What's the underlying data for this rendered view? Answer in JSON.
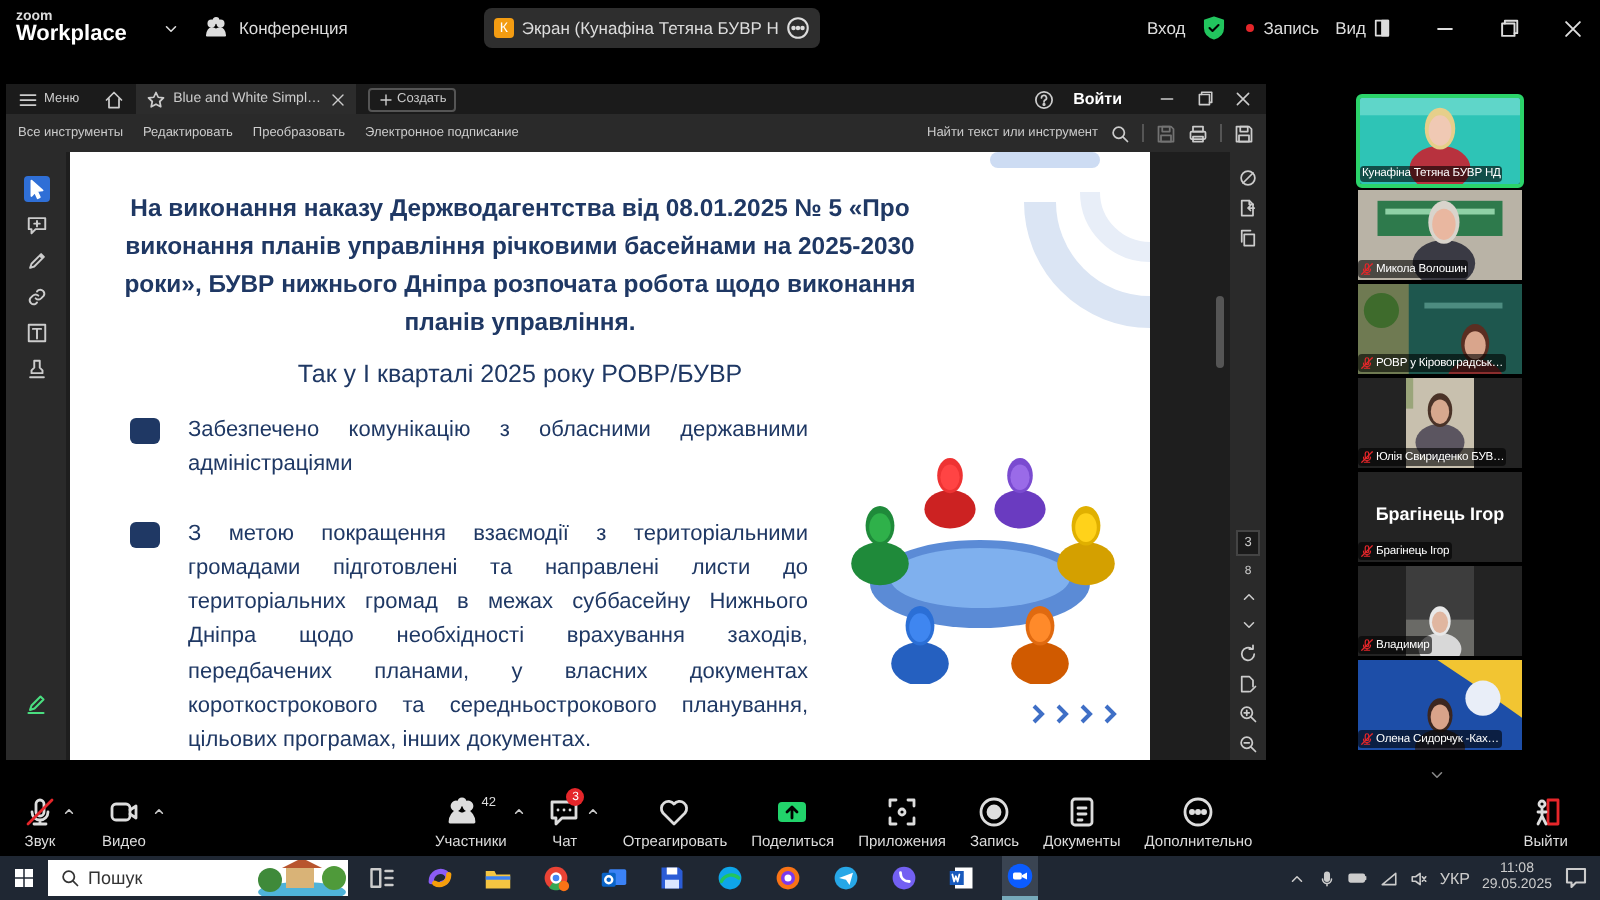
{
  "top_bar": {
    "logo_small": "zoom",
    "logo_large": "Workplace",
    "meeting": "Конференция",
    "share": {
      "badge": "К",
      "label": "Экран (Кунафіна Тетяна БУВР Н"
    },
    "signin": "Вход",
    "recording": "Запись",
    "view": "Вид"
  },
  "pdf_viewer": {
    "menu": "Меню",
    "tab": "Blue and White Simpl…",
    "new_tab": "Создать",
    "signin": "Войти",
    "tools": [
      "Все инструменты",
      "Редактировать",
      "Преобразовать",
      "Электронное подписание"
    ],
    "find": "Найти текст или инструмент",
    "left_tools": [
      {
        "kind": "pointer",
        "selected": true
      },
      {
        "kind": "comment",
        "selected": false
      },
      {
        "kind": "pen",
        "selected": false
      },
      {
        "kind": "link",
        "selected": false
      },
      {
        "kind": "textbox",
        "selected": false
      },
      {
        "kind": "stamp",
        "selected": false
      }
    ],
    "page": "3",
    "pages": "8"
  },
  "slide": {
    "title": "На виконання наказу Держводагентства від 08.01.2025 № 5 «Про виконання планів управління річковими басейнами на 2025-2030 роки», БУВР нижнього Дніпра розпочата робота щодо виконання планів управління.",
    "subtitle": "Так у І кварталі 2025 року РОВР/БУВР",
    "bullets": [
      "Забезпечено комунікацію з обласними державними адміністраціями",
      "З метою покращення взаємодії з територіальними громадами підготовлені та направлені листи до територіальних громад в межах суббасейну Нижнього Дніпра щодо необхідності врахування заходів, передбачених планами, у власних документах короткострокового та середньострокового планування, цільових програмах, інших документах."
    ]
  },
  "participants": [
    {
      "name": "Кунафіна Тетяна БУВР НД",
      "kind": "video",
      "muted": false,
      "active": true
    },
    {
      "name": "Микола Волошин",
      "kind": "video",
      "muted": true,
      "active": false
    },
    {
      "name": "РОВР у Кіровоградськ…",
      "kind": "video",
      "muted": true,
      "active": false
    },
    {
      "name": "Юлія Свириденко БУВ…",
      "kind": "narrow",
      "muted": true,
      "active": false
    },
    {
      "name": "Брагінець Ігор",
      "display_name": "Брагінець Ігор",
      "kind": "name",
      "muted": true,
      "active": false
    },
    {
      "name": "Владимир",
      "kind": "narrow",
      "muted": true,
      "active": false
    },
    {
      "name": "Олена Сидорчук -Ках…",
      "kind": "video",
      "muted": true,
      "active": false
    }
  ],
  "toolbar": [
    {
      "kind": "audio",
      "label": "Звук",
      "muted": true,
      "caret": true
    },
    {
      "kind": "video",
      "label": "Видео",
      "caret": true
    },
    {
      "kind": "participants",
      "label": "Участники",
      "count": "42",
      "caret": true
    },
    {
      "kind": "chat",
      "label": "Чат",
      "badge": "3",
      "caret": true
    },
    {
      "kind": "react",
      "label": "Отреагировать",
      "caret": false
    },
    {
      "kind": "share",
      "label": "Поделиться",
      "caret": false
    },
    {
      "kind": "apps",
      "label": "Приложения",
      "caret": false
    },
    {
      "kind": "record",
      "label": "Запись",
      "caret": false
    },
    {
      "kind": "docs",
      "label": "Документы",
      "caret": false
    },
    {
      "kind": "more",
      "label": "Дополнительно",
      "caret": false
    },
    {
      "kind": "leave",
      "label": "Выйти",
      "caret": false
    }
  ],
  "taskbar": {
    "search": "Пошук",
    "apps": [
      {
        "kind": "taskview",
        "selected": false
      },
      {
        "kind": "swirl",
        "selected": false
      },
      {
        "kind": "folder",
        "selected": false
      },
      {
        "kind": "globe",
        "selected": false
      },
      {
        "kind": "mail",
        "selected": false
      },
      {
        "kind": "floppy",
        "selected": false
      },
      {
        "kind": "wave",
        "selected": false
      },
      {
        "kind": "ring",
        "selected": false
      },
      {
        "kind": "plane",
        "selected": false
      },
      {
        "kind": "phone",
        "selected": false
      },
      {
        "kind": "doc",
        "selected": false
      },
      {
        "kind": "camera",
        "selected": true
      }
    ],
    "language": "УКР",
    "time": "11:08",
    "date": "29.05.2025"
  }
}
